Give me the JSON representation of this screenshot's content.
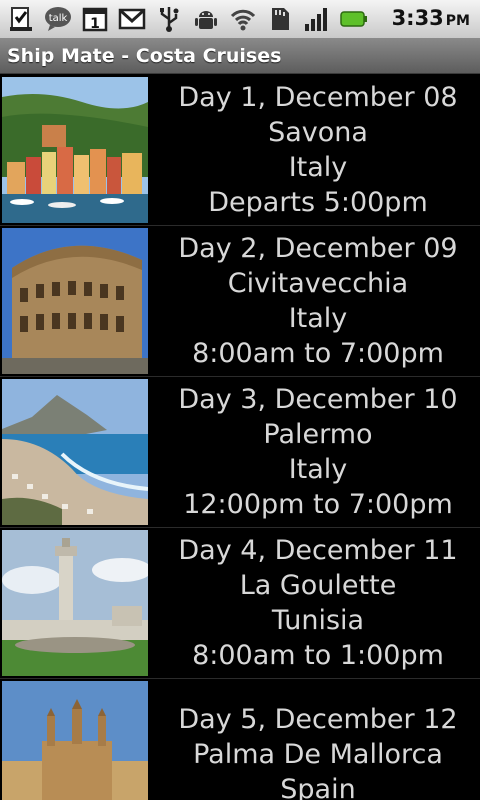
{
  "status_bar": {
    "time": "3:33",
    "ampm": "PM",
    "icons": [
      "checklist-download-icon",
      "talk-icon",
      "calendar-icon",
      "gmail-icon",
      "usb-icon",
      "android-debug-icon",
      "wifi-icon",
      "sd-card-icon",
      "signal-icon",
      "battery-icon"
    ],
    "talk_label": "talk",
    "calendar_label": "1"
  },
  "title_bar": {
    "title": "Ship Mate - Costa Cruises"
  },
  "itinerary": [
    {
      "day": "Day 1, December 08",
      "port": "Savona",
      "country": "Italy",
      "time": "Departs 5:00pm",
      "image": "portofino-harbor-photo"
    },
    {
      "day": "Day 2, December 09",
      "port": "Civitavecchia",
      "country": "Italy",
      "time": "8:00am to 7:00pm",
      "image": "colosseum-photo"
    },
    {
      "day": "Day 3, December 10",
      "port": "Palermo",
      "country": "Italy",
      "time": "12:00pm to 7:00pm",
      "image": "palermo-coast-photo"
    },
    {
      "day": "Day 4, December 11",
      "port": "La Goulette",
      "country": "Tunisia",
      "time": "8:00am to 1:00pm",
      "image": "la-goulette-tower-photo"
    },
    {
      "day": "Day 5, December 12",
      "port": "Palma De Mallorca",
      "country": "Spain",
      "time": "",
      "image": "palma-cathedral-photo"
    }
  ]
}
